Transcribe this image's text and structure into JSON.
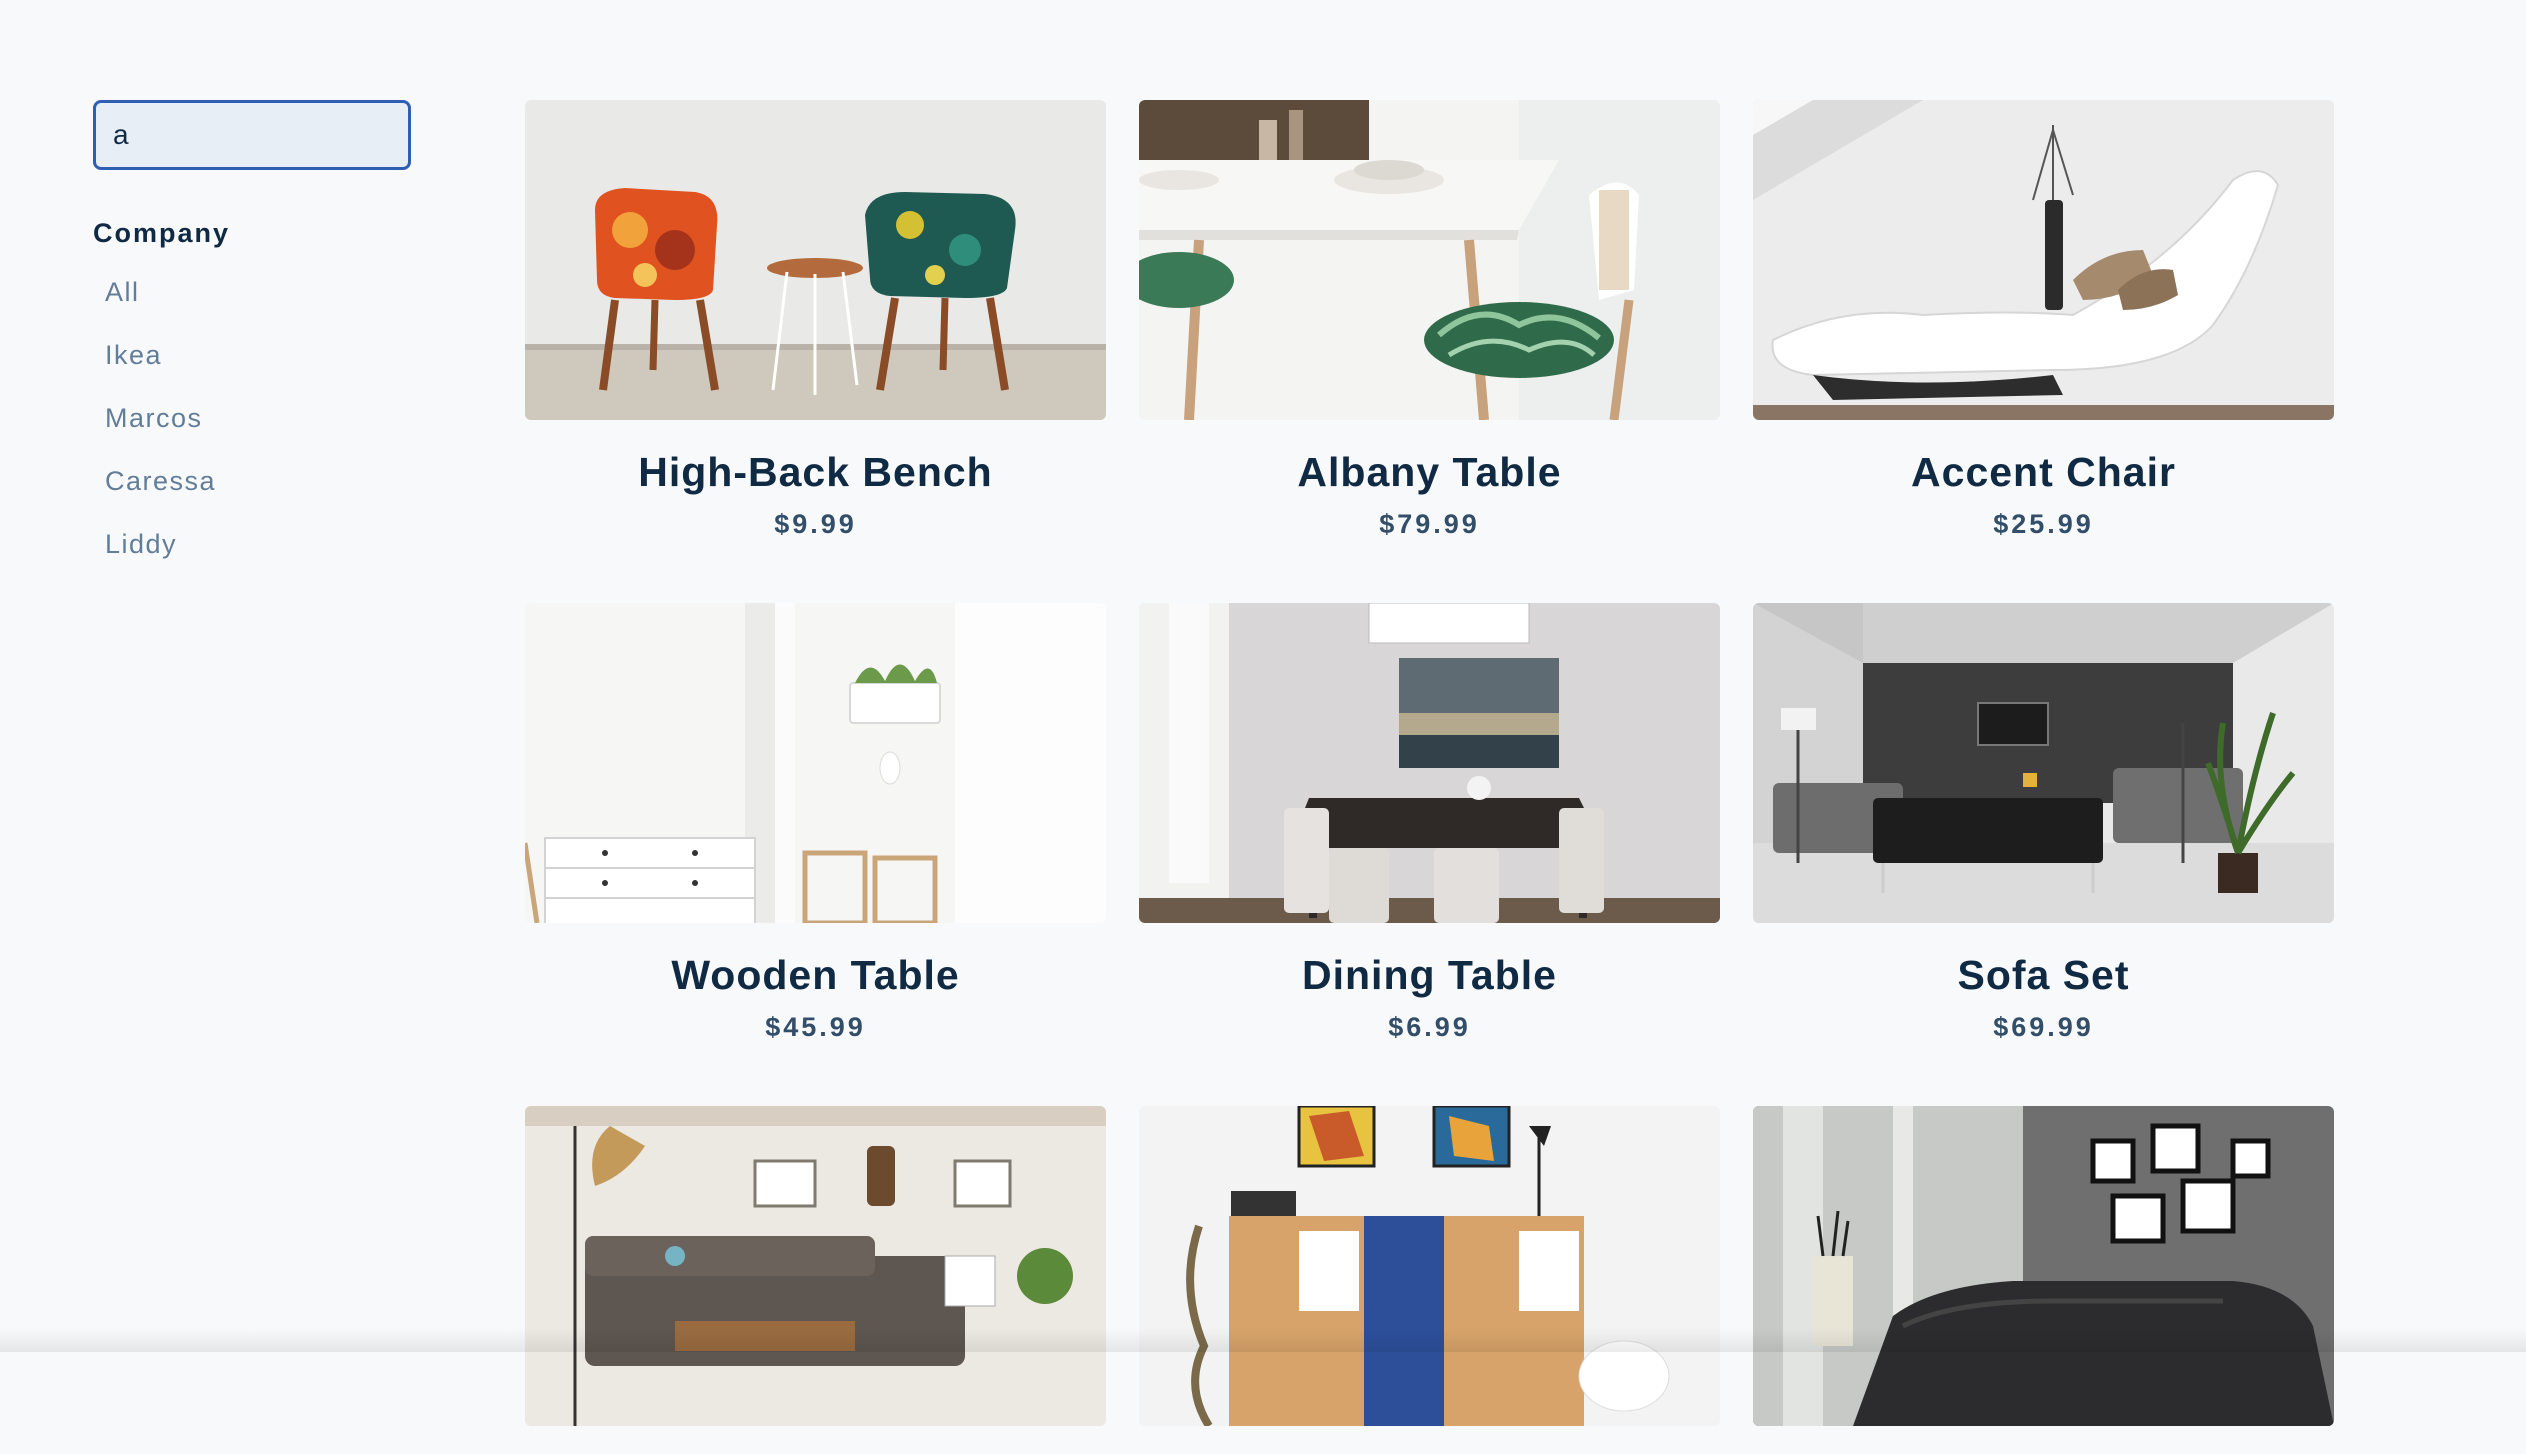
{
  "search": {
    "value": "a"
  },
  "filters": {
    "title": "Company",
    "companies": [
      "All",
      "Ikea",
      "Marcos",
      "Caressa",
      "Liddy"
    ]
  },
  "products": [
    {
      "name": "High-Back Bench",
      "price": "$9.99",
      "image": "two-accent-chairs-with-side-table"
    },
    {
      "name": "Albany Table",
      "price": "$79.99",
      "image": "dining-table-with-leaf-cushion-chair"
    },
    {
      "name": "Accent Chair",
      "price": "$25.99",
      "image": "white-chaise-lounge"
    },
    {
      "name": "Wooden Table",
      "price": "$45.99",
      "image": "white-room-with-dresser-and-chairs"
    },
    {
      "name": "Dining Table",
      "price": "$6.99",
      "image": "dark-dining-table-with-chairs"
    },
    {
      "name": "Sofa Set",
      "price": "$69.99",
      "image": "modern-living-room-sofa-set"
    },
    {
      "name": "",
      "price": "",
      "image": "rustic-living-room-sectional"
    },
    {
      "name": "",
      "price": "",
      "image": "colorful-cabinet-with-art"
    },
    {
      "name": "",
      "price": "",
      "image": "dark-corner-sectional-sofa"
    }
  ]
}
